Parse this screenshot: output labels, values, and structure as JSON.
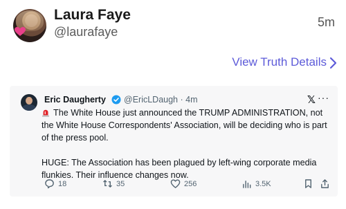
{
  "post": {
    "author_name": "Laura Faye",
    "author_handle": "@laurafaye",
    "time": "5m",
    "details_link": "View Truth Details"
  },
  "embed": {
    "author_name": "Eric Daugherty",
    "author_handle": "@EricLDaugh",
    "separator": "·",
    "time": "4m",
    "platform_icon": "x-logo",
    "more_label": "···",
    "paragraph1": "The White House just announced the TRUMP ADMINISTRATION, not the White House Correspondents' Association, will be deciding who is part of the press pool.",
    "paragraph2": "HUGE: The Association has been plagued by left-wing corporate media flunkies. Their influence changes now.",
    "stats": {
      "replies": "18",
      "reposts": "35",
      "likes": "256",
      "views": "3.5K"
    }
  },
  "colors": {
    "link": "#5d5bd9",
    "verified": "#1d9bf0",
    "muted": "#536471",
    "embed_bg": "#f7f7f8"
  }
}
